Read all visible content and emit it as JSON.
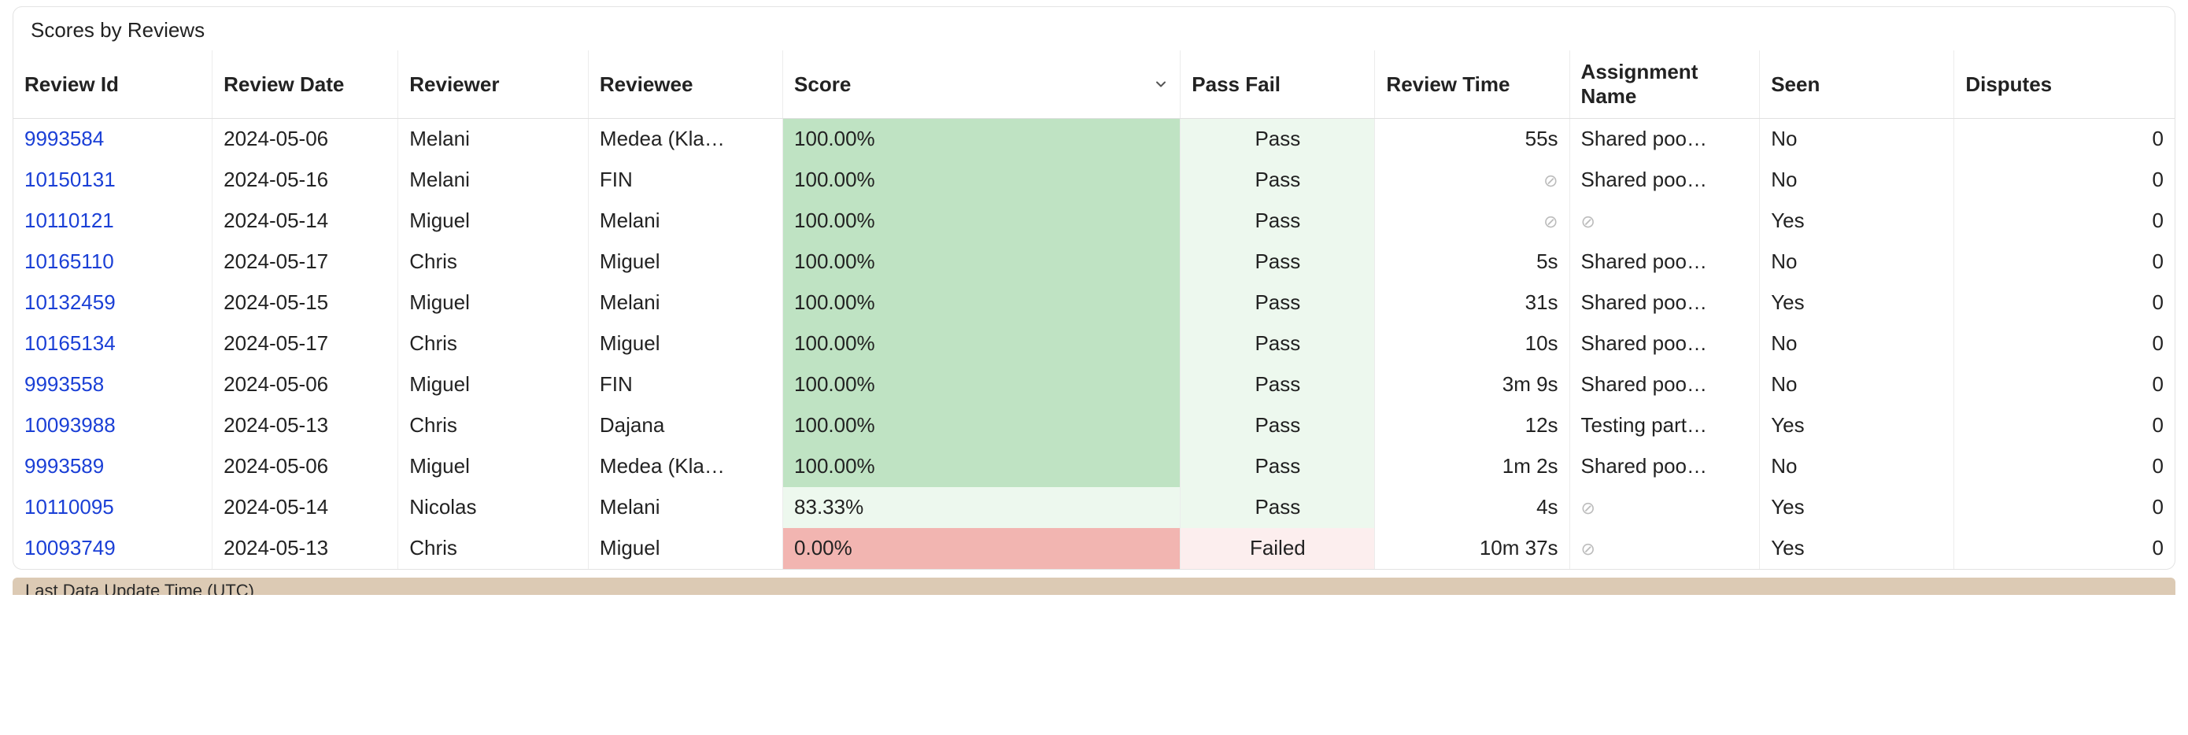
{
  "panel": {
    "title": "Scores by Reviews"
  },
  "columns": {
    "review_id": "Review Id",
    "review_date": "Review Date",
    "reviewer": "Reviewer",
    "reviewee": "Reviewee",
    "score": "Score",
    "pass_fail": "Pass Fail",
    "review_time": "Review Time",
    "assignment_name": "Assignment Name",
    "seen": "Seen",
    "disputes": "Disputes"
  },
  "sort": {
    "column": "score",
    "direction": "desc"
  },
  "null_glyph": "⊘",
  "rows": [
    {
      "review_id": "9993584",
      "review_date": "2024-05-06",
      "reviewer": "Melani",
      "reviewee": "Medea (Kla…",
      "score": "100.00%",
      "score_bucket": "high",
      "pass_fail": "Pass",
      "review_time": "55s",
      "assignment_name": "Shared poo…",
      "seen": "No",
      "disputes": "0"
    },
    {
      "review_id": "10150131",
      "review_date": "2024-05-16",
      "reviewer": "Melani",
      "reviewee": "FIN",
      "score": "100.00%",
      "score_bucket": "high",
      "pass_fail": "Pass",
      "review_time": null,
      "assignment_name": "Shared poo…",
      "seen": "No",
      "disputes": "0"
    },
    {
      "review_id": "10110121",
      "review_date": "2024-05-14",
      "reviewer": "Miguel",
      "reviewee": "Melani",
      "score": "100.00%",
      "score_bucket": "high",
      "pass_fail": "Pass",
      "review_time": null,
      "assignment_name": null,
      "seen": "Yes",
      "disputes": "0"
    },
    {
      "review_id": "10165110",
      "review_date": "2024-05-17",
      "reviewer": "Chris",
      "reviewee": "Miguel",
      "score": "100.00%",
      "score_bucket": "high",
      "pass_fail": "Pass",
      "review_time": "5s",
      "assignment_name": "Shared poo…",
      "seen": "No",
      "disputes": "0"
    },
    {
      "review_id": "10132459",
      "review_date": "2024-05-15",
      "reviewer": "Miguel",
      "reviewee": "Melani",
      "score": "100.00%",
      "score_bucket": "high",
      "pass_fail": "Pass",
      "review_time": "31s",
      "assignment_name": "Shared poo…",
      "seen": "Yes",
      "disputes": "0"
    },
    {
      "review_id": "10165134",
      "review_date": "2024-05-17",
      "reviewer": "Chris",
      "reviewee": "Miguel",
      "score": "100.00%",
      "score_bucket": "high",
      "pass_fail": "Pass",
      "review_time": "10s",
      "assignment_name": "Shared poo…",
      "seen": "No",
      "disputes": "0"
    },
    {
      "review_id": "9993558",
      "review_date": "2024-05-06",
      "reviewer": "Miguel",
      "reviewee": "FIN",
      "score": "100.00%",
      "score_bucket": "high",
      "pass_fail": "Pass",
      "review_time": "3m 9s",
      "assignment_name": "Shared poo…",
      "seen": "No",
      "disputes": "0"
    },
    {
      "review_id": "10093988",
      "review_date": "2024-05-13",
      "reviewer": "Chris",
      "reviewee": "Dajana",
      "score": "100.00%",
      "score_bucket": "high",
      "pass_fail": "Pass",
      "review_time": "12s",
      "assignment_name": "Testing part…",
      "seen": "Yes",
      "disputes": "0"
    },
    {
      "review_id": "9993589",
      "review_date": "2024-05-06",
      "reviewer": "Miguel",
      "reviewee": "Medea (Kla…",
      "score": "100.00%",
      "score_bucket": "high",
      "pass_fail": "Pass",
      "review_time": "1m 2s",
      "assignment_name": "Shared poo…",
      "seen": "No",
      "disputes": "0"
    },
    {
      "review_id": "10110095",
      "review_date": "2024-05-14",
      "reviewer": "Nicolas",
      "reviewee": "Melani",
      "score": "83.33%",
      "score_bucket": "mid",
      "pass_fail": "Pass",
      "review_time": "4s",
      "assignment_name": null,
      "seen": "Yes",
      "disputes": "0"
    },
    {
      "review_id": "10093749",
      "review_date": "2024-05-13",
      "reviewer": "Chris",
      "reviewee": "Miguel",
      "score": "0.00%",
      "score_bucket": "low",
      "pass_fail": "Failed",
      "review_time": "10m 37s",
      "assignment_name": null,
      "seen": "Yes",
      "disputes": "0"
    }
  ],
  "footer": {
    "label": "Last Data Update Time (UTC)"
  }
}
